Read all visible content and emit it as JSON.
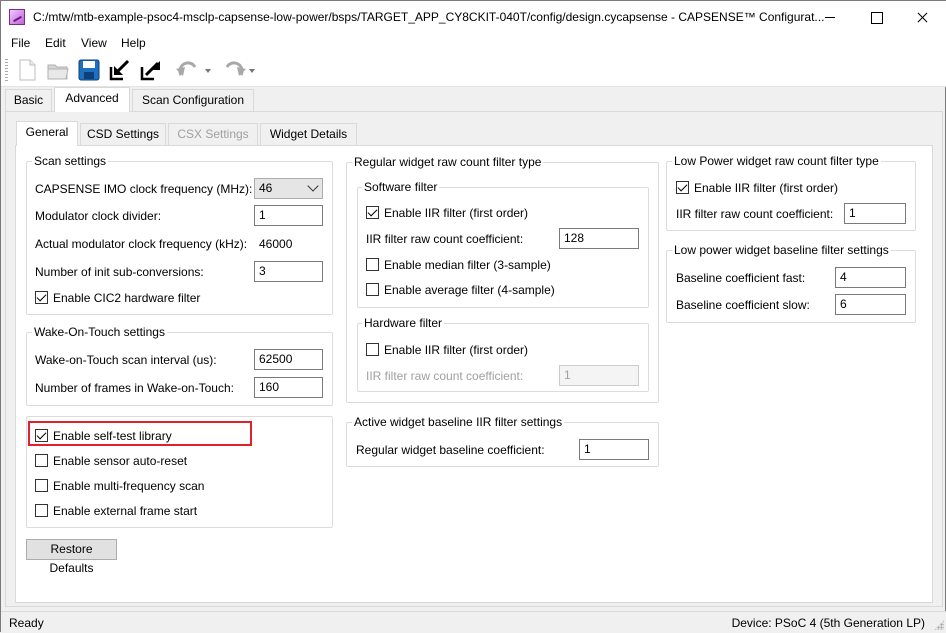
{
  "window": {
    "title": "C:/mtw/mtb-example-psoc4-msclp-capsense-low-power/bsps/TARGET_APP_CY8CKIT-040T/config/design.cycapsense - CAPSENSE™ Configurat..."
  },
  "menu": [
    "File",
    "Edit",
    "View",
    "Help"
  ],
  "toolbar": {
    "icons": [
      "new-file-icon",
      "open-folder-icon",
      "save-icon",
      "import-icon",
      "export-icon",
      "undo-icon",
      "redo-icon"
    ]
  },
  "main_tabs": [
    "Basic",
    "Advanced",
    "Scan Configuration"
  ],
  "sub_tabs": [
    "General",
    "CSD Settings",
    "CSX Settings",
    "Widget Details"
  ],
  "scan_settings": {
    "title": "Scan settings",
    "imo_label": "CAPSENSE IMO clock frequency (MHz):",
    "imo_value": "46",
    "mod_div_label": "Modulator clock divider:",
    "mod_div_value": "1",
    "actual_mod_label": "Actual modulator clock frequency (kHz):",
    "actual_mod_value": "46000",
    "init_sub_label": "Number of init sub-conversions:",
    "init_sub_value": "3",
    "cic2_label": "Enable CIC2 hardware filter",
    "cic2_checked": true
  },
  "wot_settings": {
    "title": "Wake-On-Touch settings",
    "interval_label": "Wake-on-Touch scan interval (us):",
    "interval_value": "62500",
    "frames_label": "Number of frames in Wake-on-Touch:",
    "frames_value": "160"
  },
  "misc": {
    "self_test_label": "Enable self-test library",
    "self_test_checked": true,
    "auto_reset_label": "Enable sensor auto-reset",
    "multi_freq_label": "Enable multi-frequency scan",
    "ext_frame_label": "Enable external frame start"
  },
  "restore_defaults_label": "Restore Defaults",
  "regular_filter": {
    "title": "Regular widget raw count filter type",
    "software_title": "Software filter",
    "sw_iir_label": "Enable IIR filter (first order)",
    "sw_iir_checked": true,
    "sw_iir_coef_label": "IIR filter raw count coefficient:",
    "sw_iir_coef_value": "128",
    "median_label": "Enable median filter (3-sample)",
    "average_label": "Enable average filter (4-sample)",
    "hardware_title": "Hardware filter",
    "hw_iir_label": "Enable IIR filter (first order)",
    "hw_iir_coef_label": "IIR filter raw count coefficient:",
    "hw_iir_coef_value": "1"
  },
  "active_baseline": {
    "title": "Active widget baseline IIR filter settings",
    "coef_label": "Regular widget baseline coefficient:",
    "coef_value": "1"
  },
  "lp_filter": {
    "title": "Low Power widget raw count filter type",
    "iir_label": "Enable IIR filter (first order)",
    "iir_checked": true,
    "coef_label": "IIR filter raw count coefficient:",
    "coef_value": "1"
  },
  "lp_baseline": {
    "title": "Low power widget baseline filter settings",
    "fast_label": "Baseline coefficient fast:",
    "fast_value": "4",
    "slow_label": "Baseline coefficient slow:",
    "slow_value": "6"
  },
  "status": {
    "left": "Ready",
    "right": "Device: PSoC 4 (5th Generation LP)"
  },
  "colors": {
    "highlight": "#e0202a",
    "accent_blue": "#1e6fbf"
  }
}
